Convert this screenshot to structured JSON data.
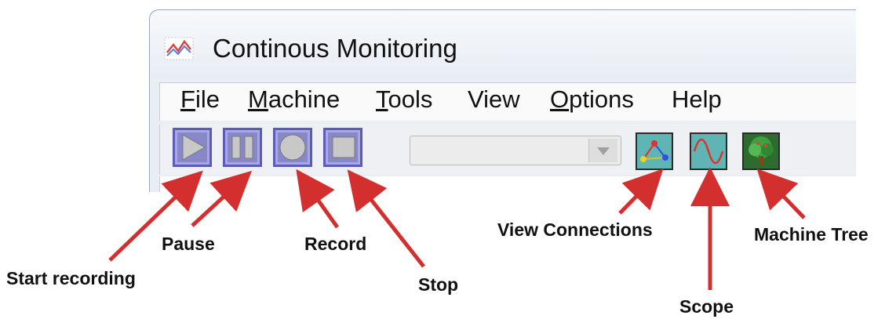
{
  "window": {
    "title": "Continous Monitoring",
    "icon": "chart-line-icon"
  },
  "menu": [
    {
      "label": "File"
    },
    {
      "label": "Machine"
    },
    {
      "label": "Tools"
    },
    {
      "label": "View"
    },
    {
      "label": "Options"
    },
    {
      "label": "Help"
    }
  ],
  "toolbar": {
    "buttons": [
      {
        "icon": "play-icon"
      },
      {
        "icon": "pause-icon"
      },
      {
        "icon": "record-icon"
      },
      {
        "icon": "stop-icon"
      }
    ],
    "combo_value": "",
    "tools": [
      {
        "icon": "connections-icon"
      },
      {
        "icon": "scope-wave-icon"
      },
      {
        "icon": "tree-icon"
      }
    ]
  },
  "callouts": {
    "start_recording": "Start recording",
    "pause": "Pause",
    "record": "Record",
    "stop": "Stop",
    "view_connections": "View Connections",
    "scope": "Scope",
    "machine_tree": "Machine Tree"
  },
  "colors": {
    "arrow": "#d32f2f",
    "toolbar_button": "#a8a8e6",
    "toolbar_button_border": "#5b5bb8"
  }
}
